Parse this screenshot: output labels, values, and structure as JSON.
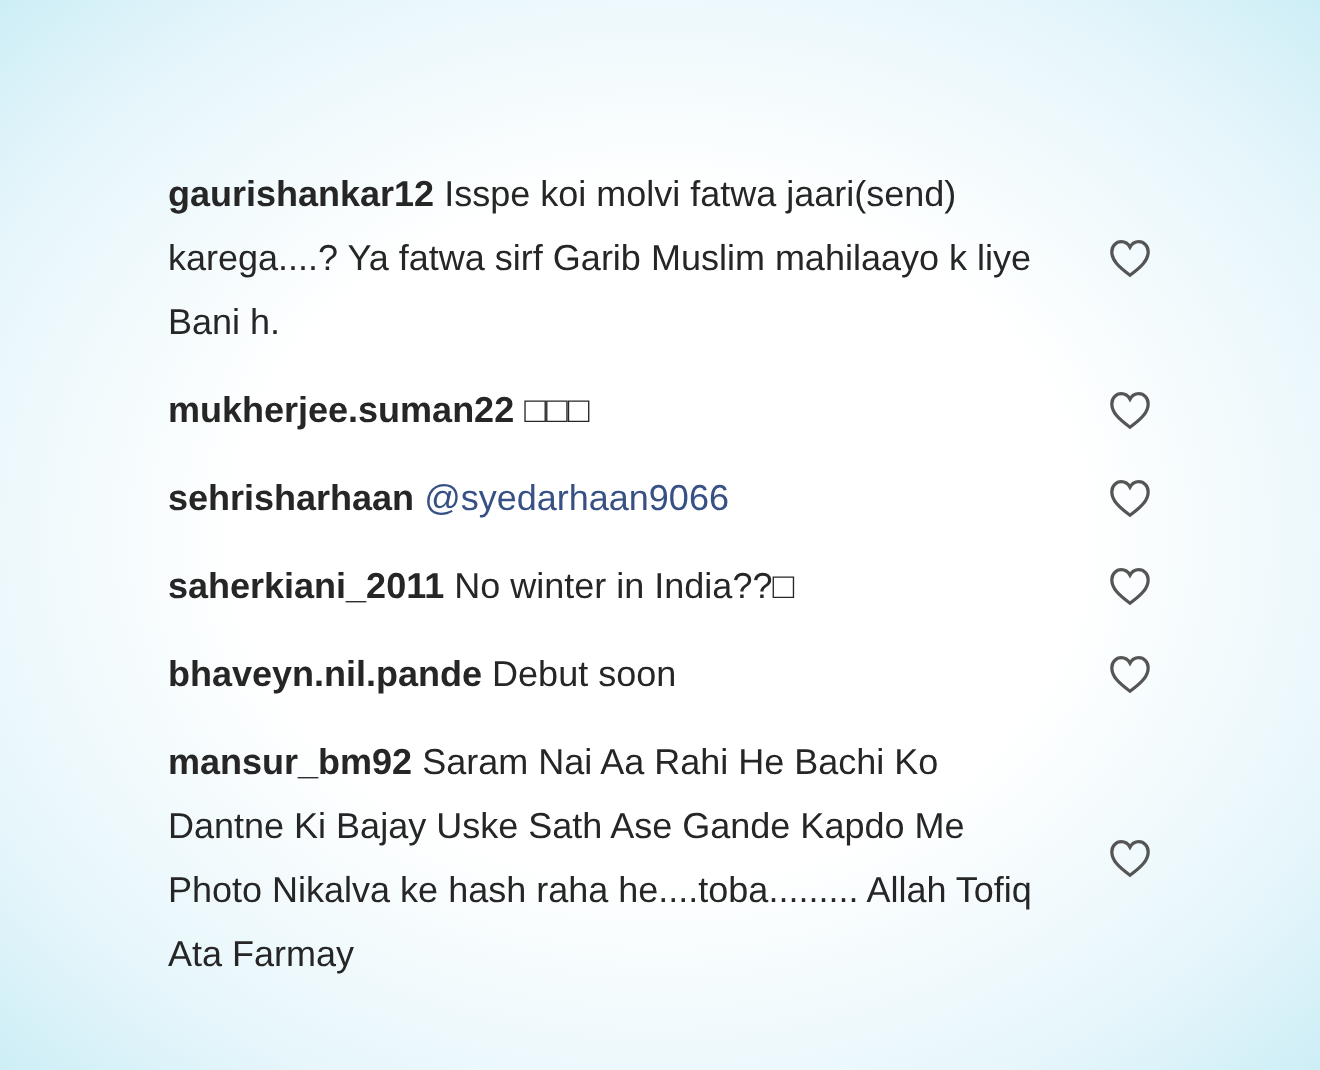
{
  "comments": [
    {
      "text": "**gaurishankar12** Isspe koi molvi fatwa jaari(send) karega....? Ya fatwa sirf Garib Muslim mahilaayo k liye Bani h.",
      "liked": false
    },
    {
      "text": "**mukherjee.suman22** □□□",
      "liked": false
    },
    {
      "text": "**sehrisharhaan**",
      "mention": "@syedarhaan9066",
      "liked": false
    },
    {
      "text": "**saherkiani_2011** No winter in India??□",
      "liked": false
    },
    {
      "text": "**bhaveyn.nil.pande** Debut soon",
      "liked": false
    },
    {
      "text": "**mansur_bm92** Saram Nai Aa Rahi He Bachi Ko Dantne Ki Bajay Uske Sath Ase Gande Kapdo Me Photo Nikalva ke hash raha he....toba......... Allah Tofiq Ata Farmay",
      "liked": false
    }
  ]
}
